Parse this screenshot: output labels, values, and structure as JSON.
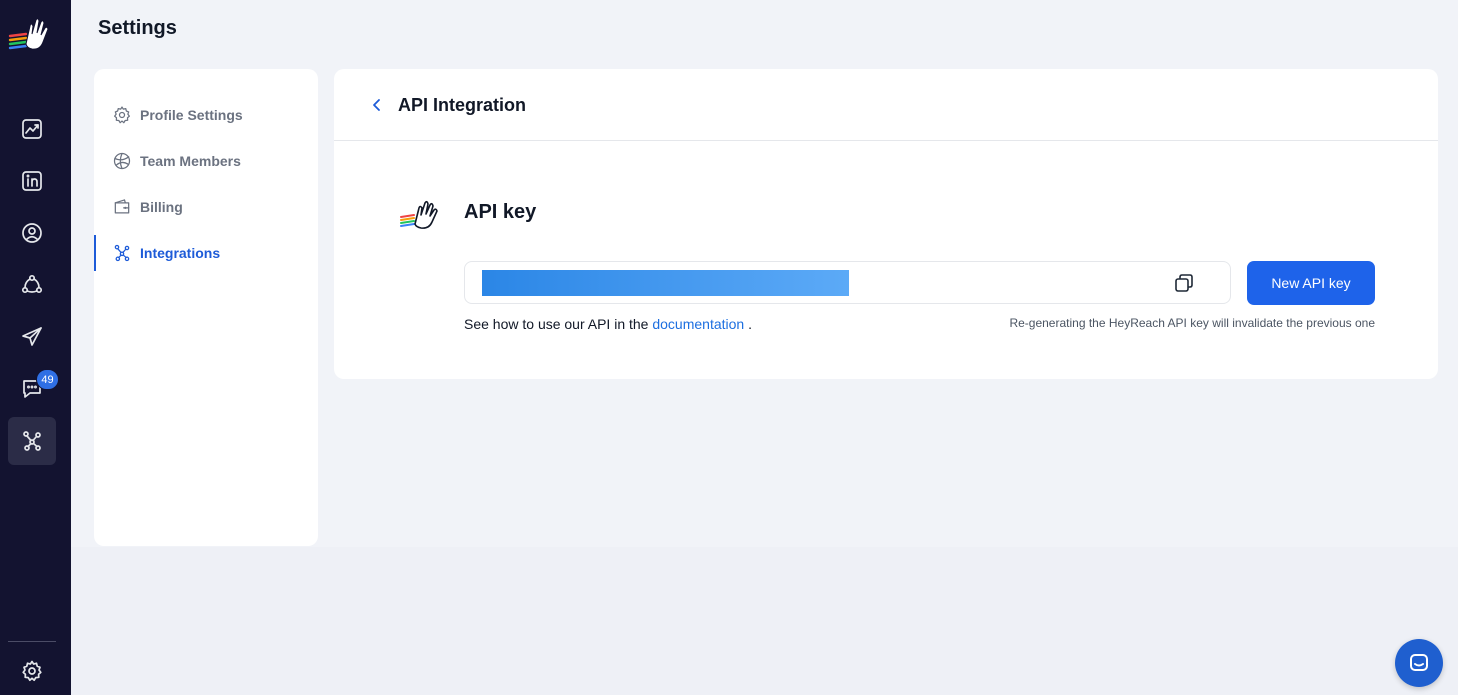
{
  "app": {
    "page_title": "Settings",
    "brand_icon": "heyreach-wave-hand-logo"
  },
  "rail": {
    "items": [
      {
        "name": "analytics",
        "icon": "trending-chart-icon"
      },
      {
        "name": "linkedin-accounts",
        "icon": "linkedin-icon"
      },
      {
        "name": "leads",
        "icon": "user-circle-icon"
      },
      {
        "name": "network",
        "icon": "network-icon"
      },
      {
        "name": "campaigns",
        "icon": "send-icon"
      },
      {
        "name": "inbox",
        "icon": "chat-icon",
        "badge": "49"
      },
      {
        "name": "integrations",
        "icon": "integrations-icon",
        "active": true
      }
    ],
    "settings_icon": "gear-icon"
  },
  "settings_nav": {
    "items": [
      {
        "label": "Profile Settings",
        "icon": "gear-icon"
      },
      {
        "label": "Team Members",
        "icon": "globe-icon"
      },
      {
        "label": "Billing",
        "icon": "wallet-icon"
      },
      {
        "label": "Integrations",
        "icon": "integrations-icon",
        "active": true
      }
    ]
  },
  "main": {
    "title": "API Integration",
    "section_title": "API key",
    "new_key_label": "New API key",
    "help_prefix": "See how to use our API in the",
    "help_link": "documentation",
    "help_suffix": ".",
    "warning": "Re-generating the HeyReach API key will invalidate the previous one"
  },
  "colors": {
    "rail_bg": "#131330",
    "accent": "#1e63ea",
    "badge": "#2f6fe4"
  }
}
